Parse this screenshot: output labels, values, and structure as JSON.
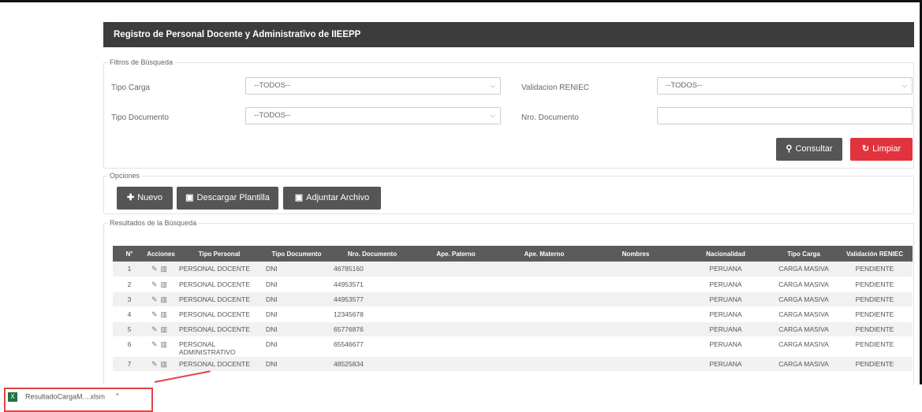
{
  "header": {
    "title": "Registro de Personal Docente y Administrativo de IIEEPP"
  },
  "filters": {
    "legend": "Filtros de Búsqueda",
    "tipo_carga_label": "Tipo Carga",
    "tipo_carga_value": "--TODOS--",
    "validacion_label": "Validacion RENIEC",
    "validacion_value": "--TODOS--",
    "tipo_documento_label": "Tipo Documento",
    "tipo_documento_value": "--TODOS--",
    "nro_documento_label": "Nro. Documento",
    "nro_documento_value": "",
    "consultar_label": "Consultar",
    "limpiar_label": "Limpiar"
  },
  "options": {
    "legend": "Opciones",
    "nuevo_label": "Nuevo",
    "descargar_label": "Descargar Plantilla",
    "adjuntar_label": "Adjuntar Archivo"
  },
  "results": {
    "legend": "Resultados de la Búsqueda",
    "columns": [
      "N°",
      "Acciones",
      "Tipo Personal",
      "Tipo Documento",
      "Nro. Documento",
      "Ape. Paterno",
      "Ape. Materno",
      "Nombres",
      "Nacionalidad",
      "Tipo Carga",
      "Validación RENIEC"
    ],
    "rows": [
      {
        "n": "1",
        "tipo_personal": "PERSONAL DOCENTE",
        "tipo_documento": "DNI",
        "nro": "46785160",
        "paterno": "",
        "materno": "",
        "nombres": "",
        "nacionalidad": "PERUANA",
        "tipo_carga": "CARGA MASIVA",
        "validacion": "PENDIENTE"
      },
      {
        "n": "2",
        "tipo_personal": "PERSONAL DOCENTE",
        "tipo_documento": "DNI",
        "nro": "44953571",
        "paterno": "",
        "materno": "",
        "nombres": "",
        "nacionalidad": "PERUANA",
        "tipo_carga": "CARGA MASIVA",
        "validacion": "PENDIENTE"
      },
      {
        "n": "3",
        "tipo_personal": "PERSONAL DOCENTE",
        "tipo_documento": "DNI",
        "nro": "44953577",
        "paterno": "",
        "materno": "",
        "nombres": "",
        "nacionalidad": "PERUANA",
        "tipo_carga": "CARGA MASIVA",
        "validacion": "PENDIENTE"
      },
      {
        "n": "4",
        "tipo_personal": "PERSONAL DOCENTE",
        "tipo_documento": "DNI",
        "nro": "12345678",
        "paterno": "",
        "materno": "",
        "nombres": "",
        "nacionalidad": "PERUANA",
        "tipo_carga": "CARGA MASIVA",
        "validacion": "PENDIENTE"
      },
      {
        "n": "5",
        "tipo_personal": "PERSONAL DOCENTE",
        "tipo_documento": "DNI",
        "nro": "65776876",
        "paterno": "",
        "materno": "",
        "nombres": "",
        "nacionalidad": "PERUANA",
        "tipo_carga": "CARGA MASIVA",
        "validacion": "PENDIENTE"
      },
      {
        "n": "6",
        "tipo_personal": "PERSONAL ADMINISTRATIVO",
        "tipo_documento": "DNI",
        "nro": "65546677",
        "paterno": "",
        "materno": "",
        "nombres": "",
        "nacionalidad": "PERUANA",
        "tipo_carga": "CARGA MASIVA",
        "validacion": "PENDIENTE"
      },
      {
        "n": "7",
        "tipo_personal": "PERSONAL DOCENTE",
        "tipo_documento": "DNI",
        "nro": "48525834",
        "paterno": "",
        "materno": "",
        "nombres": "",
        "nacionalidad": "PERUANA",
        "tipo_carga": "CARGA MASIVA",
        "validacion": "PENDIENTE"
      }
    ]
  },
  "download_bar": {
    "file_name": "ResultadoCargaM....xlsm"
  },
  "colors": {
    "header_bg": "#3c3c3c",
    "accent_red": "#e0333d",
    "button_dark": "#555555",
    "table_header": "#5b5b5b",
    "excel_green": "#1f7244"
  },
  "icons": {
    "edit": "pencil-icon",
    "delete": "trash-icon",
    "search": "search-icon",
    "refresh": "refresh-icon",
    "add": "plus-circle-icon",
    "file": "file-icon",
    "excel": "excel-file-icon"
  }
}
